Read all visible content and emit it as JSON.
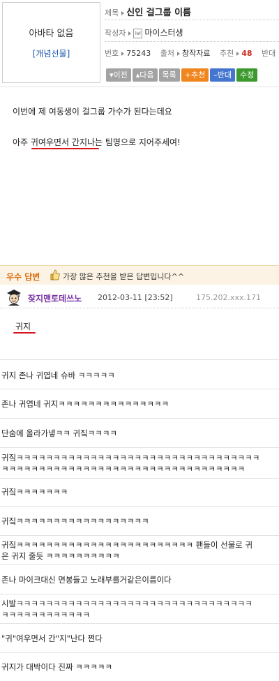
{
  "avatar": {
    "no_avatar": "아바타 없음",
    "gift_link": "[개념선물]"
  },
  "meta": {
    "title_label": "제목",
    "title": "신인 걸그룹 이름",
    "author_label": "작성자",
    "level_icon_text": "lvl",
    "author": "마이스터생",
    "number_label": "번호",
    "number": "75243",
    "source_label": "출처",
    "source": "창작자료",
    "rec_label": "추천",
    "rec": "48",
    "opp_label": "반대"
  },
  "buttons": {
    "prev": "▾이전",
    "next": "▴다음",
    "list": "목록",
    "recommend": "+추천",
    "oppose": "–반대",
    "edit": "수정"
  },
  "post": {
    "line1": "이번에 제 여동생이 걸그룹 가수가 된다는데요",
    "line2": "아주 귀여우면서 간지나는 팀명으로 지어주세여!"
  },
  "best_answer": {
    "label": "우수 답변",
    "description": "가장 많은 추천을 받은 답변입니다^^",
    "name": "잦지맨토데쓰노",
    "date": "2012-03-11 [23:52]",
    "ip": "175.202.xxx.171",
    "body": "귀지"
  },
  "comments": [
    {
      "line1": "귀지 존나 귀엽네 슈바 ㅋㅋㅋㅋㅋ",
      "line2": ""
    },
    {
      "line1": "존나 귀엽네 귀지ㅋㅋㅋㅋㅋㅋㅋㅋㅋㅋㅋㅋㅋㅋㅋ",
      "line2": ""
    },
    {
      "line1": "단숨에 올라가넿ㅋㅋ 귀짘ㅋㅋㅋㅋ",
      "line2": ""
    },
    {
      "line1": "귀짘ㅋㅋㅋㅋㅋㅋㅋㅋㅋㅋㅋㅋㅋㅋㅋㅋㅋㅋㅋㅋㅋㅋㅋㅋㅋㅋㅋㅋㅋㅋㅋㅋㅋ",
      "line2": "ㅋㅋㅋㅋㅋㅋㅋㅋㅋㅋㅋㅋㅋㅋㅋㅋㅋㅋㅋㅋㅋㅋㅋㅋㅋㅋㅋㅋㅋㅋㅋㅋㅋ"
    },
    {
      "line1": "귀짘ㅋㅋㅋㅋㅋㅋㅋ",
      "line2": ""
    },
    {
      "line1": "귀짘ㅋㅋㅋㅋㅋㅋㅋㅋㅋㅋㅋㅋㅋㅋㅋㅋㅋㅋ",
      "line2": ""
    },
    {
      "line1": "귀짘ㅋㅋㅋㅋㅋㅋㅋㅋㅋㅋㅋㅋㅋㅋㅋㅋㅋㅋㅋㅋㅋㅋㅋㅋ 팬들이 선물로 귀",
      "line2": "은 귀지 줄듯 ㅋㅋㅋㅋㅋㅋㅋㅋㅋㅋ"
    },
    {
      "line1": "존나 마이크대신 면봉들고 노래부를거같은이름이다",
      "line2": ""
    },
    {
      "line1": "시발ㅋㅋㅋㅋㅋㅋㅋㅋㅋㅋㅋㅋㅋㅋㅋㅋㅋㅋㅋㅋㅋㅋㅋㅋㅋㅋㅋㅋㅋㅋㅋㅋ",
      "line2": "ㅋㅋㅋㅋㅋㅋㅋㅋㅋㅋㅋㅋ"
    },
    {
      "line1": "\"귀\"여우면서 간\"지\"난다 쩐다",
      "line2": ""
    },
    {
      "line1": "귀지가 대박이다 진짜 ㅋㅋㅋㅋㅋ",
      "line2": ""
    }
  ]
}
